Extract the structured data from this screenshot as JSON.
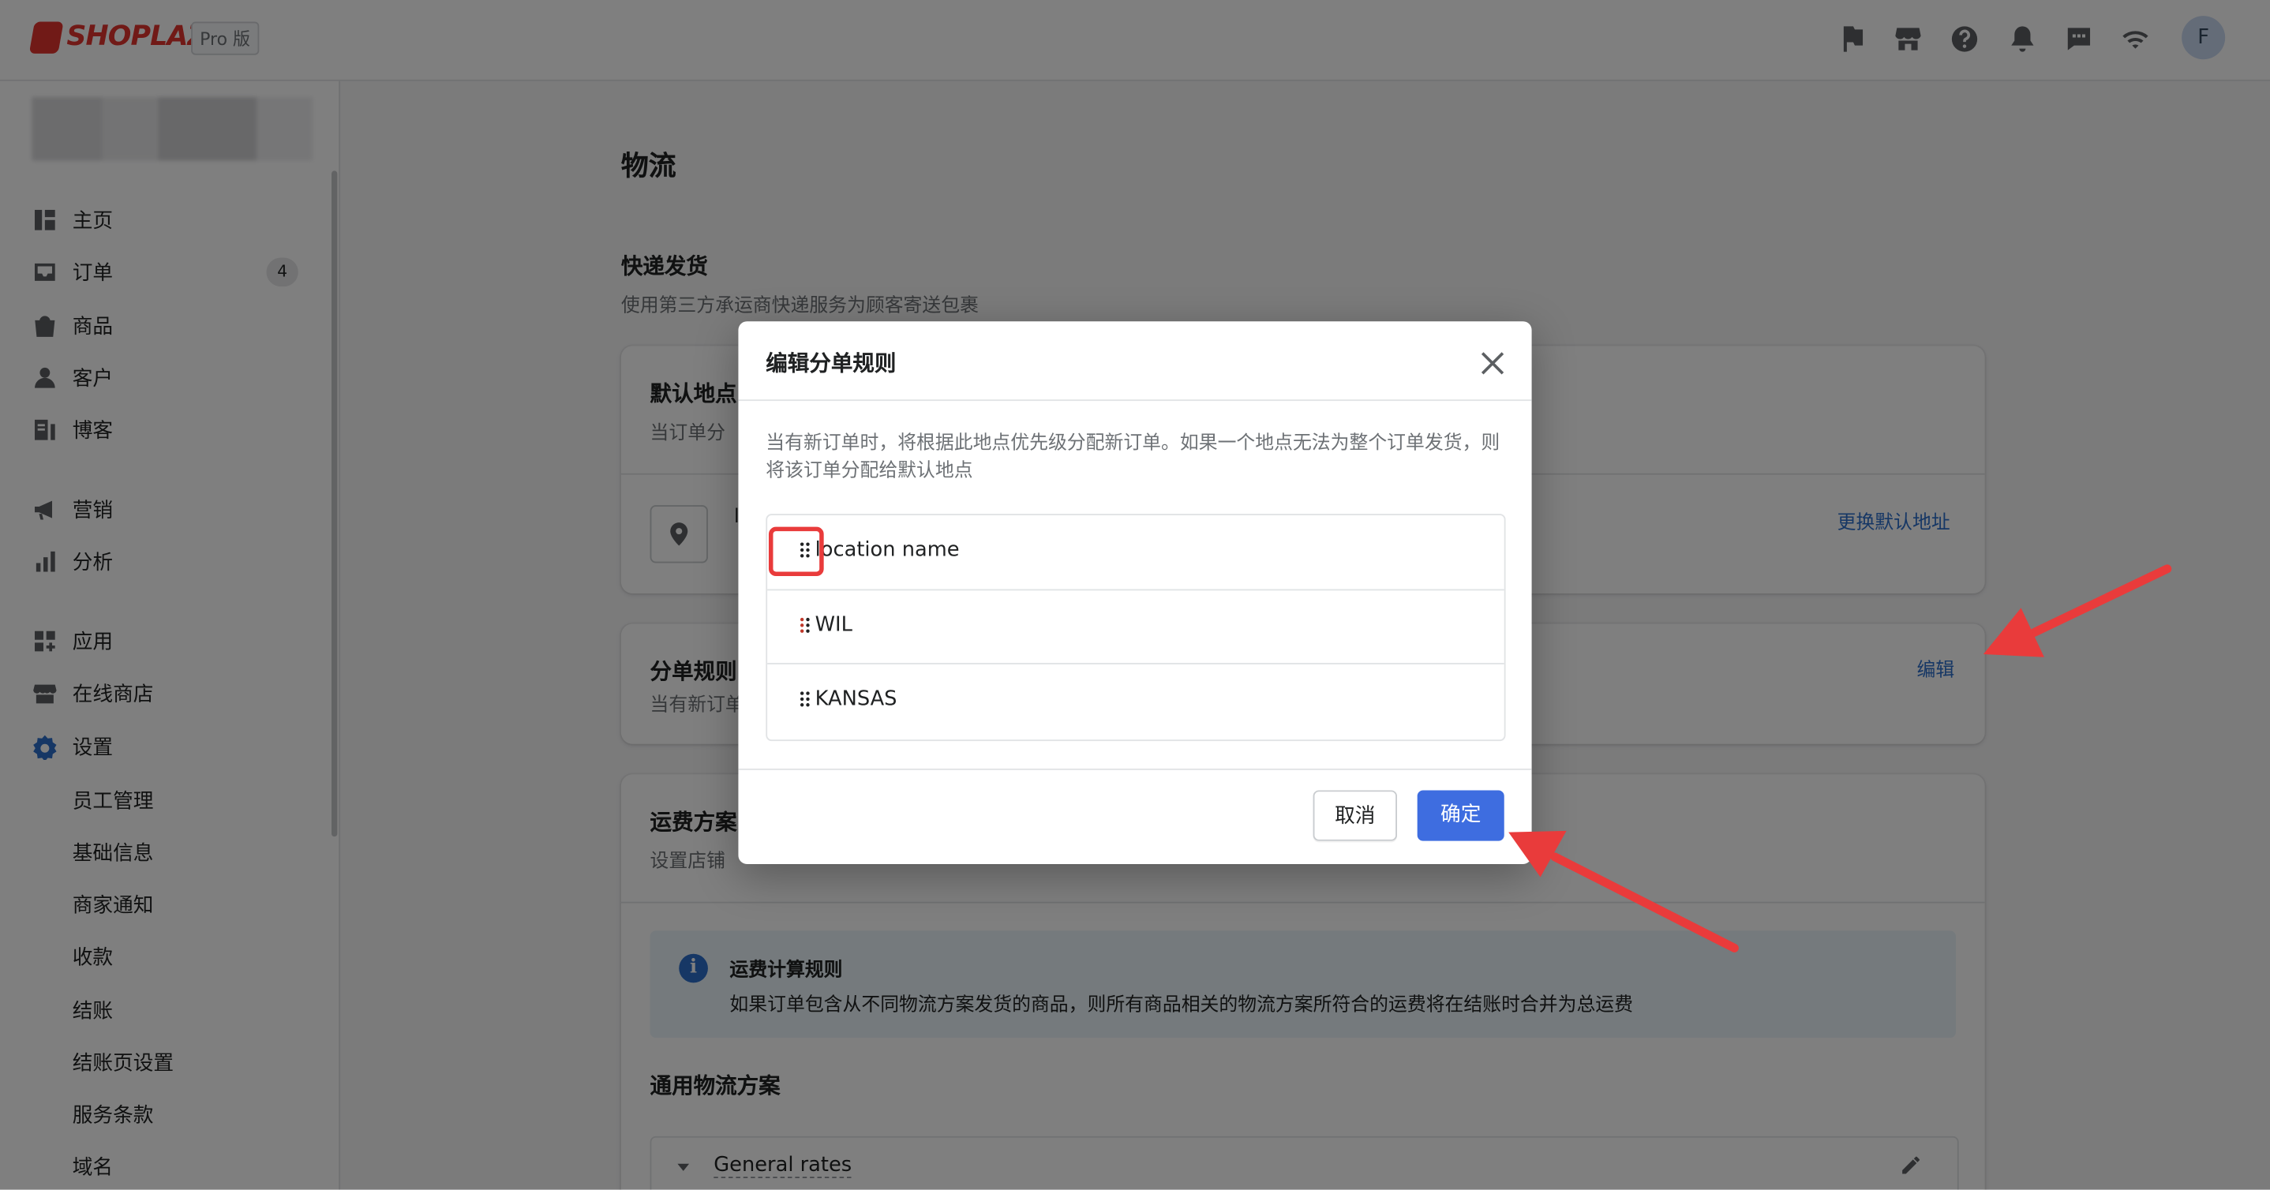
{
  "header": {
    "brand": "SHOPLAZZA",
    "plan_badge": "Pro 版",
    "avatar_initial": "F"
  },
  "sidebar": {
    "items": [
      {
        "label": "主页"
      },
      {
        "label": "订单",
        "badge": "4"
      },
      {
        "label": "商品"
      },
      {
        "label": "客户"
      },
      {
        "label": "博客"
      },
      {
        "label": "营销"
      },
      {
        "label": "分析"
      },
      {
        "label": "应用"
      },
      {
        "label": "在线商店"
      },
      {
        "label": "设置"
      }
    ],
    "settings_sub": [
      "员工管理",
      "基础信息",
      "商家通知",
      "收款",
      "结账",
      "结账页设置",
      "服务条款",
      "域名"
    ]
  },
  "main": {
    "page_title": "物流",
    "section_title": "快递发货",
    "section_desc": "使用第三方承运商快递服务为顾客寄送包裹",
    "default_location": {
      "title": "默认地点",
      "desc": "当订单分",
      "change_link": "更换默认地址",
      "name_initial": "l"
    },
    "split_rules": {
      "title": "分单规则",
      "desc": "当有新订单",
      "edit_link": "编辑"
    },
    "shipping_plans": {
      "title": "运费方案",
      "desc": "设置店铺",
      "banner_title": "运费计算规则",
      "banner_text": "如果订单包含从不同物流方案发货的商品，则所有商品相关的物流方案所符合的运费将在结账时合并为总运费",
      "general_title": "通用物流方案",
      "general_rates": "General rates"
    }
  },
  "modal": {
    "title": "编辑分单规则",
    "description": "当有新订单时，将根据此地点优先级分配新订单。如果一个地点无法为整个订单发货，则将该订单分配给默认地点",
    "locations": [
      "location name",
      "WIL",
      "KANSAS"
    ],
    "cancel_label": "取消",
    "confirm_label": "确定"
  },
  "colors": {
    "accent": "#3e6de0",
    "link": "#2c6ecb",
    "brand": "#e3342f",
    "annotation": "#e93b3b"
  }
}
